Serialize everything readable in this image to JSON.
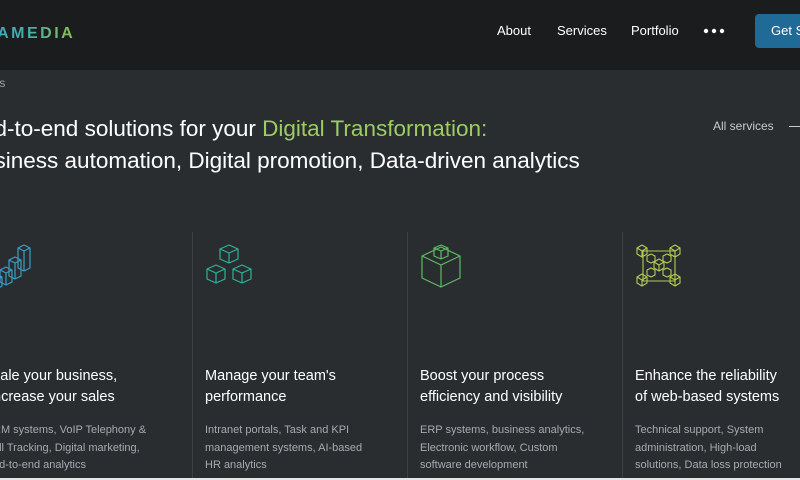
{
  "header": {
    "logo": "TAMEDIA",
    "nav": [
      "About",
      "Services",
      "Portfolio"
    ],
    "more_icon": "more-dots-icon",
    "cta": "Get S"
  },
  "breadcrumb": "vices",
  "headline": {
    "line1_plain": "nd-to-end solutions for your ",
    "line1_accent": "Digital Transformation:",
    "line2": "usiness automation, Digital promotion, Data-driven analytics"
  },
  "all_services": "All services",
  "colors": {
    "background": "#2a2d30",
    "header": "#1b1c1e",
    "accent_green": "#9dcc62",
    "cta_blue": "#1f6a97",
    "icon_blue": "#3b9dc4",
    "icon_teal": "#2bb39a",
    "icon_green": "#5dbb63",
    "icon_lime": "#b4cc4f"
  },
  "cards": [
    {
      "icon": "bar-chart-cubes-icon",
      "title": [
        "cale your business,",
        "ncrease your sales"
      ],
      "desc": [
        "RM systems, VoIP Telephony &",
        "all Tracking, Digital marketing,",
        "nd-to-end analytics"
      ]
    },
    {
      "icon": "stacked-cubes-icon",
      "title": [
        "Manage your team's",
        "performance"
      ],
      "desc": [
        "Intranet portals, Task and KPI",
        "management systems, AI-based",
        "HR analytics"
      ]
    },
    {
      "icon": "cube-in-box-icon",
      "title": [
        "Boost your process",
        "efficiency and visibility"
      ],
      "desc": [
        "ERP systems, business analytics,",
        "Electronic workflow, Custom",
        "software development"
      ]
    },
    {
      "icon": "connected-cubes-network-icon",
      "title": [
        "Enhance the reliability",
        "of web-based systems"
      ],
      "desc": [
        "Technical support, System",
        "administration, High-load",
        "solutions, Data loss protection"
      ]
    }
  ]
}
